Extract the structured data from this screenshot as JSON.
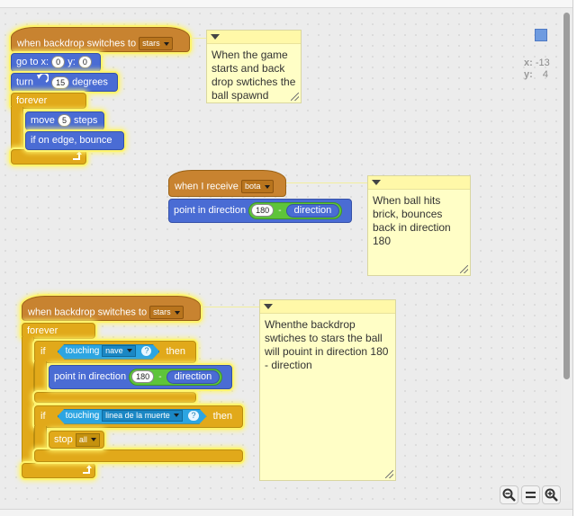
{
  "script1": {
    "hat_label": "when backdrop switches to",
    "hat_menu": "stars",
    "goto_label_a": "go to x:",
    "goto_x": "0",
    "goto_label_b": "y:",
    "goto_y": "0",
    "turn_label": "turn",
    "turn_value": "15",
    "turn_suffix": "degrees",
    "forever_label": "forever",
    "move_label": "move",
    "move_value": "5",
    "move_suffix": "steps",
    "bounce_label": "if on edge, bounce"
  },
  "script2": {
    "hat_label": "when I receive",
    "hat_menu": "bota",
    "point_label": "point in direction",
    "op_value": "180",
    "op_symbol": "-",
    "reporter": "direction"
  },
  "script3": {
    "hat_label": "when backdrop switches to",
    "hat_menu": "stars",
    "forever_label": "forever",
    "if1_label": "if",
    "touching1_label": "touching",
    "touching1_menu": "nave",
    "touching1_q": "?",
    "then1_label": "then",
    "point_label": "point in direction",
    "op_value": "180",
    "op_symbol": "-",
    "reporter": "direction",
    "if2_label": "if",
    "touching2_label": "touching",
    "touching2_menu": "linea de la muerte",
    "touching2_q": "?",
    "then2_label": "then",
    "stop_label": "stop",
    "stop_menu": "all"
  },
  "notes": {
    "note1": "When the game starts and back drop swtiches the ball spawnd",
    "note2": "When ball hits brick, bounces back in direction 180",
    "note3": "Whenthe backdrop swtiches to stars the ball will pouint in direction 180 - direction"
  },
  "stage_info": {
    "x_label": "x:",
    "x_value": "-13",
    "y_label": "y:",
    "y_value": "4"
  },
  "icons": {
    "turn": "rotate-left-icon",
    "loop": "loop-arrow-icon",
    "zoom_out": "zoom-out-icon",
    "zoom_reset": "zoom-reset-icon",
    "zoom_in": "zoom-in-icon"
  },
  "colors": {
    "events": "#c88330",
    "control": "#e1a91a",
    "motion": "#4a6cd4",
    "sensing": "#2ca5e2",
    "operators": "#5ec43a",
    "note": "#fffec6",
    "glow": "#fff46e"
  }
}
